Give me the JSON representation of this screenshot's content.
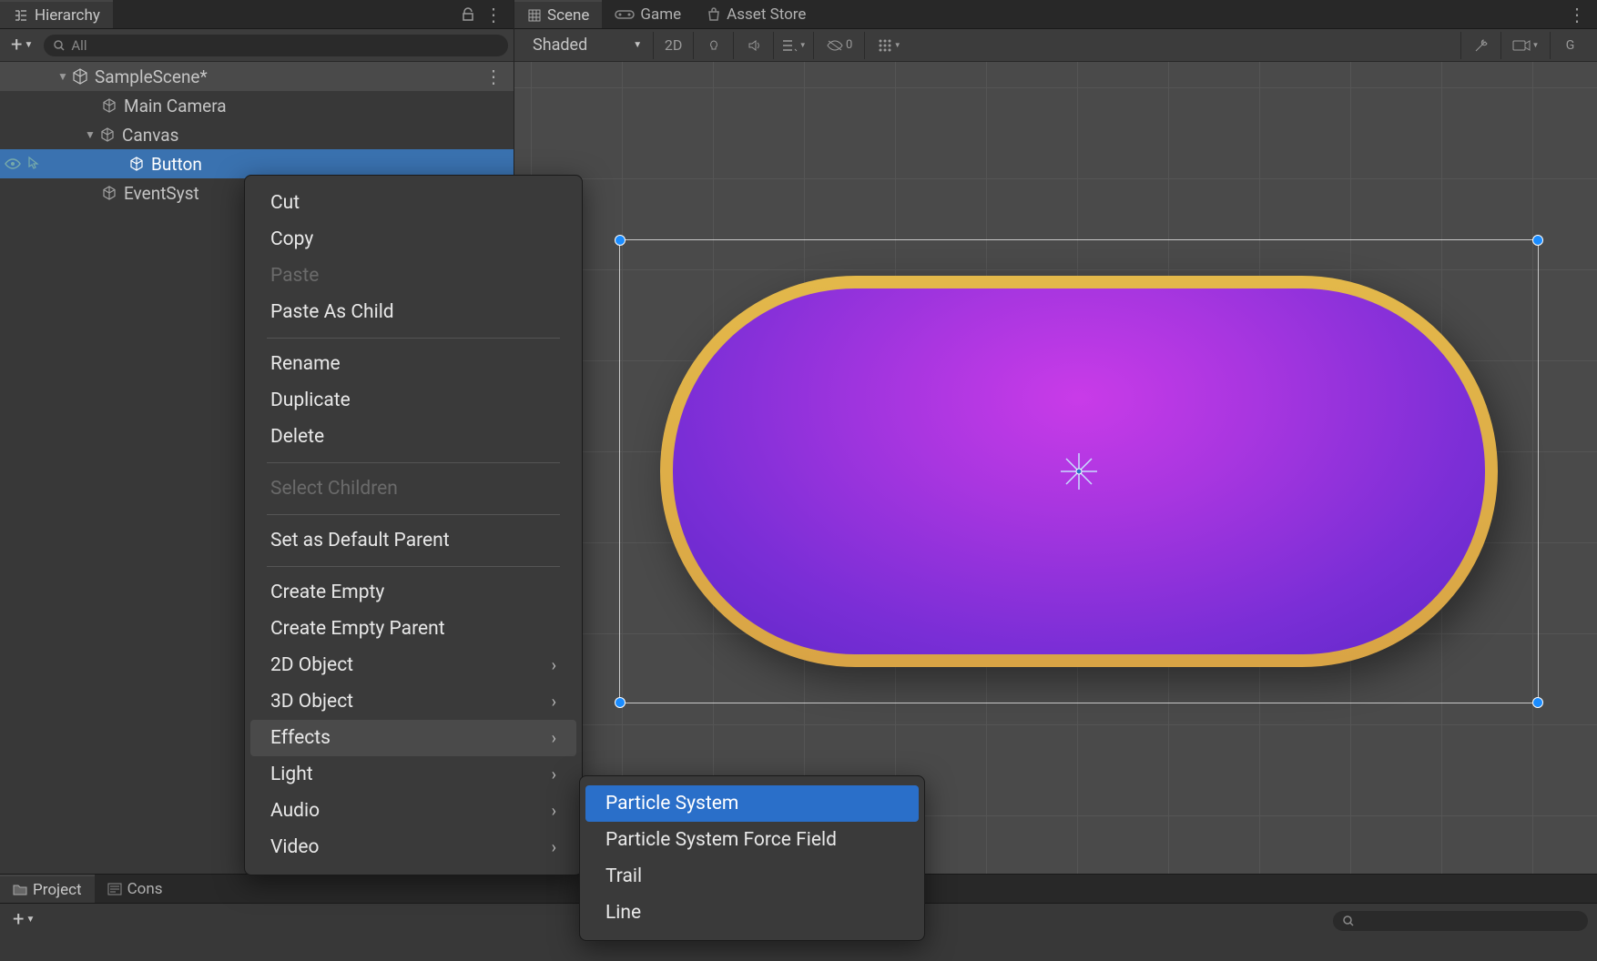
{
  "hierarchy": {
    "title": "Hierarchy",
    "search_placeholder": "All",
    "scene_name": "SampleScene*",
    "items": [
      {
        "label": "Main Camera",
        "indent": 2
      },
      {
        "label": "Canvas",
        "indent": 2,
        "expanded": true
      },
      {
        "label": "Button",
        "indent": 3,
        "selected": true
      },
      {
        "label": "EventSyst",
        "indent": 2
      }
    ]
  },
  "scene_tabs": {
    "scene": "Scene",
    "game": "Game",
    "asset_store": "Asset Store"
  },
  "scene_toolbar": {
    "shading": "Shaded",
    "mode_2d": "2D"
  },
  "context_menu": {
    "cut": "Cut",
    "copy": "Copy",
    "paste": "Paste",
    "paste_as_child": "Paste As Child",
    "rename": "Rename",
    "duplicate": "Duplicate",
    "delete": "Delete",
    "select_children": "Select Children",
    "set_default_parent": "Set as Default Parent",
    "create_empty": "Create Empty",
    "create_empty_parent": "Create Empty Parent",
    "object_2d": "2D Object",
    "object_3d": "3D Object",
    "effects": "Effects",
    "light": "Light",
    "audio": "Audio",
    "video": "Video"
  },
  "effects_submenu": {
    "particle_system": "Particle System",
    "particle_system_force_field": "Particle System Force Field",
    "trail": "Trail",
    "line": "Line"
  },
  "bottom": {
    "project": "Project",
    "console": "Cons"
  }
}
